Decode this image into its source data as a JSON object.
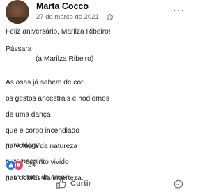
{
  "post": {
    "author": "Marta Cocco",
    "date": "27 de março de 2021",
    "separator": "·",
    "privacy_icon": "globe-icon",
    "more_label": "···",
    "greeting": "Feliz aniversário, Marilza Ribeiro!",
    "poem_title": "Pássara",
    "poem_dedication": "(a Marilza Ribeiro)",
    "stanza1": [
      "As asas já sabem de cor",
      "os gestos ancestrais e hodiernos",
      "de uma dança",
      "que é corpo incendiado",
      "na volúpia da natureza",
      "que é espírito vivido",
      "nas dobras da incerteza."
    ],
    "stanza2": [
      "pura magia",
      "pura poesia",
      "puro canto de amor."
    ]
  },
  "reactions": {
    "icons": [
      "like-icon",
      "love-icon"
    ],
    "count": "24",
    "colors": {
      "like": "#1877f2",
      "love": "#f33e58"
    }
  },
  "actions": {
    "like_label": "Curtir",
    "like_icon": "thumbs-up-icon",
    "second_icon": "messenger-icon"
  }
}
